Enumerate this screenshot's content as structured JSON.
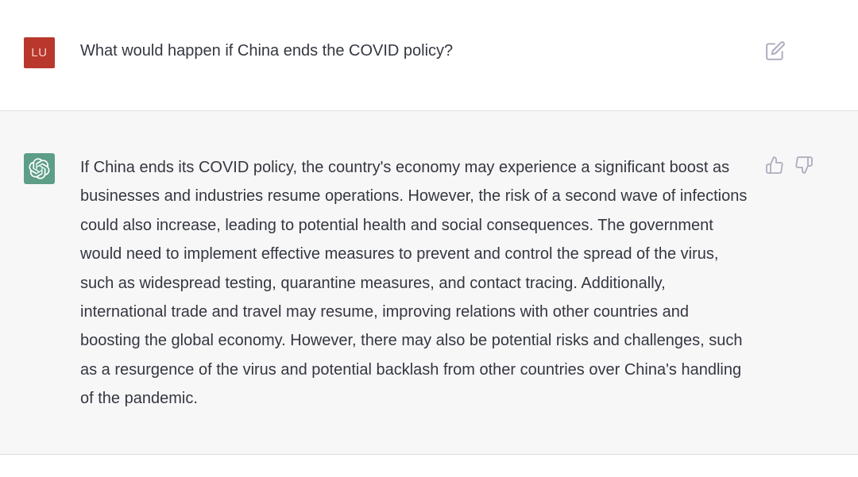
{
  "user_message": {
    "avatar_initials": "LU",
    "text": "What would happen if China ends the COVID policy?",
    "edit_icon": "edit-icon"
  },
  "assistant_message": {
    "avatar_icon": "openai-logo-icon",
    "text": "If China ends its COVID policy, the country's economy may experience a significant boost as businesses and industries resume operations. However, the risk of a second wave of infections could also increase, leading to potential health and social consequences. The government would need to implement effective measures to prevent and control the spread of the virus, such as widespread testing, quarantine measures, and contact tracing. Additionally, international trade and travel may resume, improving relations with other countries and boosting the global economy. However, there may also be potential risks and challenges, such as a resurgence of the virus and potential backlash from other countries over China's handling of the pandemic.",
    "feedback_icons": [
      "thumbs-up-icon",
      "thumbs-down-icon"
    ]
  },
  "colors": {
    "user_avatar": "#b9372c",
    "bot_avatar": "#5d9e87",
    "assistant_bg": "#f7f7f8",
    "text": "#353740",
    "icon": "#acacbe"
  }
}
